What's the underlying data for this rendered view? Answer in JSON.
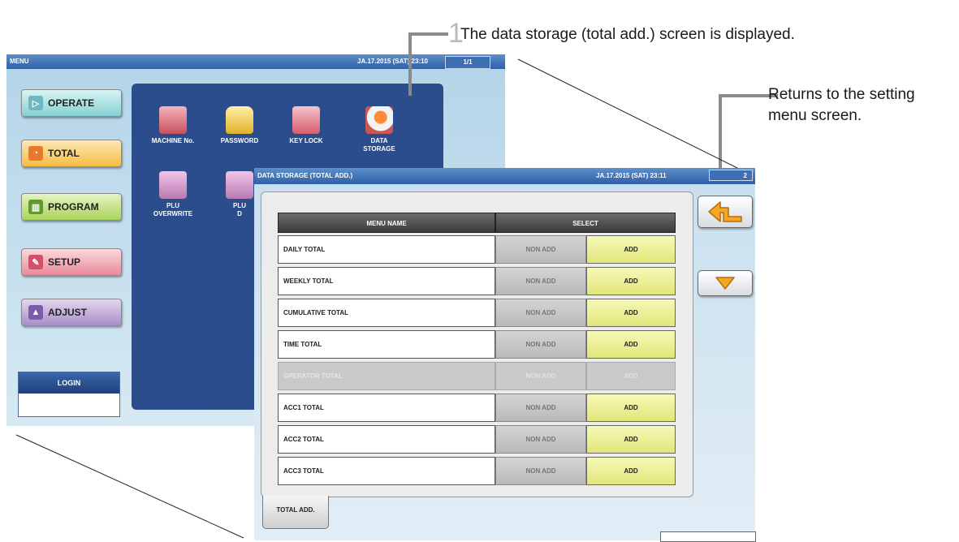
{
  "annotations": {
    "step_number": "1",
    "step_text": "The data storage (total add.) screen is displayed.",
    "return_text_line1": "Returns to the setting",
    "return_text_line2": "menu screen."
  },
  "menu_window": {
    "title": "MENU",
    "datetime": "JA.17.2015 (SAT) 23:10",
    "page": "1/1",
    "buttons": [
      {
        "label": "OPERATE",
        "icon": "play-icon"
      },
      {
        "label": "TOTAL",
        "icon": "clock-icon"
      },
      {
        "label": "PROGRAM",
        "icon": "book-icon"
      },
      {
        "label": "SETUP",
        "icon": "wrench-icon"
      },
      {
        "label": "ADJUST",
        "icon": "scale-icon"
      }
    ],
    "login_label": "LOGIN",
    "tiles": [
      {
        "line1": "MACHINE No.",
        "line2": "",
        "icon": "number-icon"
      },
      {
        "line1": "PASSWORD",
        "line2": "",
        "icon": "lock-icon"
      },
      {
        "line1": "KEY LOCK",
        "line2": "",
        "icon": "keypad-icon"
      },
      {
        "line1": "DATA",
        "line2": "STORAGE",
        "icon": "storage-icon"
      },
      {
        "line1": "PLU",
        "line2": "OVERWRITE",
        "icon": "plu-icon"
      },
      {
        "line1": "PLU",
        "line2": "D",
        "icon": "plu-icon"
      }
    ]
  },
  "storage_window": {
    "title": "DATA STORAGE (TOTAL ADD.)",
    "datetime": "JA.17.2015 (SAT) 23:11",
    "page": "2",
    "header_menu_name": "MENU NAME",
    "header_select": "SELECT",
    "rows": [
      {
        "name": "DAILY TOTAL",
        "non_add": "NON ADD",
        "add": "ADD",
        "enabled": true
      },
      {
        "name": "WEEKLY TOTAL",
        "non_add": "NON ADD",
        "add": "ADD",
        "enabled": true
      },
      {
        "name": "CUMULATIVE TOTAL",
        "non_add": "NON ADD",
        "add": "ADD",
        "enabled": true
      },
      {
        "name": "TIME TOTAL",
        "non_add": "NON ADD",
        "add": "ADD",
        "enabled": true
      },
      {
        "name": "OPERATOR TOTAL",
        "non_add": "NON ADD",
        "add": "ADD",
        "enabled": false
      },
      {
        "name": "ACC1 TOTAL",
        "non_add": "NON ADD",
        "add": "ADD",
        "enabled": true
      },
      {
        "name": "ACC2 TOTAL",
        "non_add": "NON ADD",
        "add": "ADD",
        "enabled": true
      },
      {
        "name": "ACC3 TOTAL",
        "non_add": "NON ADD",
        "add": "ADD",
        "enabled": true
      }
    ],
    "tab_label": "TOTAL ADD.",
    "colors": {
      "accent_orange": "#f5a623",
      "add_yellow": "#e1e67a"
    }
  }
}
